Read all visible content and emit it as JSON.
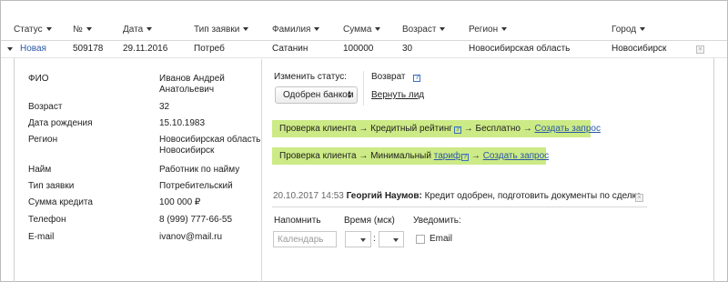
{
  "header": {
    "columns": [
      {
        "label": "Статус"
      },
      {
        "label": "№"
      },
      {
        "label": "Дата"
      },
      {
        "label": "Тип заявки"
      },
      {
        "label": "Фамилия"
      },
      {
        "label": "Сумма"
      },
      {
        "label": "Возраст"
      },
      {
        "label": "Регион"
      },
      {
        "label": "Город"
      }
    ]
  },
  "row": {
    "status": "Новая",
    "number": "509178",
    "date": "29.11.2016",
    "type": "Потреб",
    "surname": "Сатанин",
    "sum": "100000",
    "age": "30",
    "region": "Новосибирская область",
    "city": "Новосибирск",
    "close": "×"
  },
  "details": {
    "fio_label": "ФИО",
    "fio_value_1": "Иванов Андрей",
    "fio_value_2": "Анатольевич",
    "age_label": "Возраст",
    "age_value": "32",
    "birth_label": "Дата рождения",
    "birth_value": "15.10.1983",
    "region_label": "Регион",
    "region_value_1": "Новосибирская область",
    "region_value_2": "Новосибирск",
    "employment_label": "Найм",
    "employment_value": "Работник по найму",
    "type_label": "Тип заявки",
    "type_value": "Потребительский",
    "credit_label": "Сумма кредита",
    "credit_value": "100 000 ₽",
    "phone_label": "Телефон",
    "phone_value": "8 (999) 777-66-55",
    "email_label": "E-mail",
    "email_value": "ivanov@mail.ru"
  },
  "actions": {
    "change_status_label": "Изменить статус:",
    "status_select_value": "Одобрен банком",
    "return_label": "Возврат",
    "return_lead_link": "Вернуть лид",
    "help_glyph": "?"
  },
  "checks": {
    "credit_rating": {
      "prefix": "Проверка клиента → Кредитный рейтинг",
      "middle": " → Бесплатно → ",
      "link": "Создать запрос"
    },
    "minimal": {
      "prefix": "Проверка клиента → Минимальный ",
      "tariff_link": "тариф",
      "middle": " → ",
      "link": "Создать запрос"
    }
  },
  "comment": {
    "timestamp": "20.10.2017 14:53",
    "author": "Георгий Наумов:",
    "text": " Кредит одобрен, подготовить документы по сделке",
    "close": "×"
  },
  "reminder": {
    "remind_label": "Напомнить",
    "time_label": "Время (мск)",
    "notify_label": "Уведомить:",
    "calendar_placeholder": "Календарь",
    "time_separator": ":",
    "email_label": "Email"
  },
  "colors": {
    "link": "#2a57a6",
    "highlight": "#ccea86"
  }
}
